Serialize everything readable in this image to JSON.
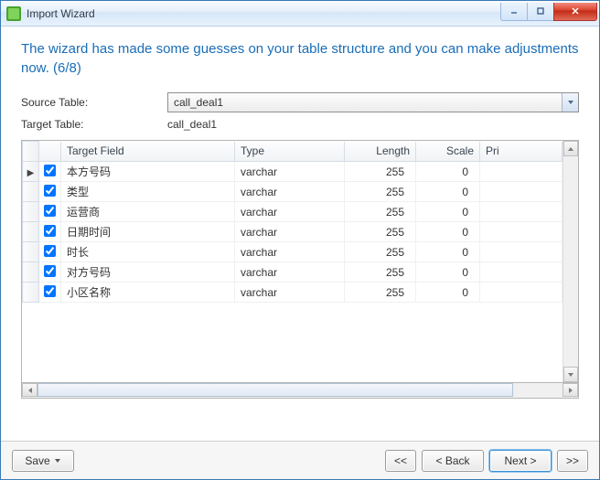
{
  "window": {
    "title": "Import Wizard"
  },
  "heading": "The wizard has made some guesses on your table structure and you can make adjustments now. (6/8)",
  "form": {
    "source_label": "Source Table:",
    "source_value": "call_deal1",
    "target_label": "Target Table:",
    "target_value": "call_deal1"
  },
  "grid": {
    "headers": {
      "target_field": "Target Field",
      "type": "Type",
      "length": "Length",
      "scale": "Scale",
      "primary": "Pri"
    },
    "rows": [
      {
        "checked": true,
        "current": true,
        "target_field": "本方号码",
        "type": "varchar",
        "length": "255",
        "scale": "0"
      },
      {
        "checked": true,
        "current": false,
        "target_field": "类型",
        "type": "varchar",
        "length": "255",
        "scale": "0"
      },
      {
        "checked": true,
        "current": false,
        "target_field": "运营商",
        "type": "varchar",
        "length": "255",
        "scale": "0"
      },
      {
        "checked": true,
        "current": false,
        "target_field": "日期时间",
        "type": "varchar",
        "length": "255",
        "scale": "0"
      },
      {
        "checked": true,
        "current": false,
        "target_field": "时长",
        "type": "varchar",
        "length": "255",
        "scale": "0"
      },
      {
        "checked": true,
        "current": false,
        "target_field": "对方号码",
        "type": "varchar",
        "length": "255",
        "scale": "0"
      },
      {
        "checked": true,
        "current": false,
        "target_field": "小区名称",
        "type": "varchar",
        "length": "255",
        "scale": "0"
      }
    ]
  },
  "footer": {
    "save": "Save",
    "first": "<<",
    "back": "< Back",
    "next": "Next >",
    "last": ">>"
  }
}
